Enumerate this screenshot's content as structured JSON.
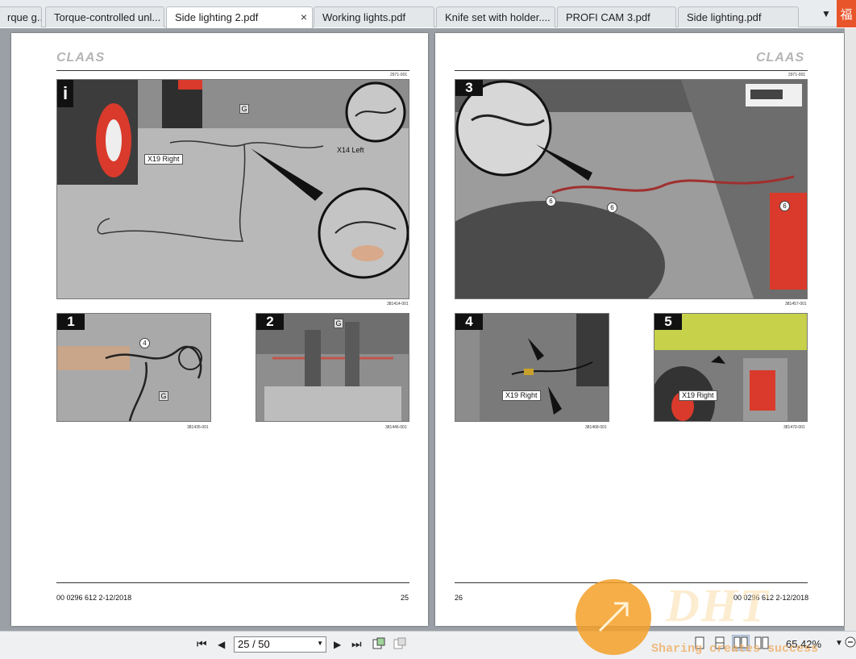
{
  "tabs": [
    {
      "label": "rque g..."
    },
    {
      "label": "Torque-controlled unl..."
    },
    {
      "label": "Side lighting 2.pdf",
      "active": true
    },
    {
      "label": "Working lights.pdf"
    },
    {
      "label": "Knife set with holder...."
    },
    {
      "label": "PROFI CAM 3.pdf"
    },
    {
      "label": "Side lighting.pdf"
    }
  ],
  "tab_close": "×",
  "tab_dropdown": "▼",
  "corner_badge": "福",
  "left_page": {
    "logo": "CLAAS",
    "doc_number": "2971-001",
    "main_figure": {
      "badge": "i",
      "callout_g": "G",
      "label_right": "X19 Right",
      "label_left": "X14 Left",
      "image_id": "381414-001"
    },
    "fig1": {
      "badge": "1",
      "callout_num": "4",
      "callout_g": "G",
      "image_id": "381435-001"
    },
    "fig2": {
      "badge": "2",
      "callout_g": "G",
      "image_id": "381446-001"
    },
    "footer_doc": "00 0296 612 2-12/2018",
    "page_number": "25"
  },
  "right_page": {
    "logo": "CLAAS",
    "doc_number": "2971-001",
    "main_figure": {
      "badge": "3",
      "callout_num": "6",
      "image_id": "381457-001"
    },
    "fig4": {
      "badge": "4",
      "label": "X19 Right",
      "image_id": "381468-001"
    },
    "fig5": {
      "badge": "5",
      "label": "X19 Right",
      "image_id": "381470-001"
    },
    "footer_doc": "00 0296 612 2-12/2018",
    "page_number": "26"
  },
  "toolbar": {
    "first": "⏮",
    "prev": "◀",
    "page_value": "25 / 50",
    "next": "▶",
    "last": "⏭",
    "zoom": "65.42%"
  },
  "watermark": {
    "text": "DHT",
    "slogan": "Sharing creates success"
  },
  "colors": {
    "claas_red": "#d93a2b",
    "tab_bg": "#e4e7ea",
    "doc_bg": "#9aa0a6",
    "watermark_orange": "#f5a028"
  }
}
